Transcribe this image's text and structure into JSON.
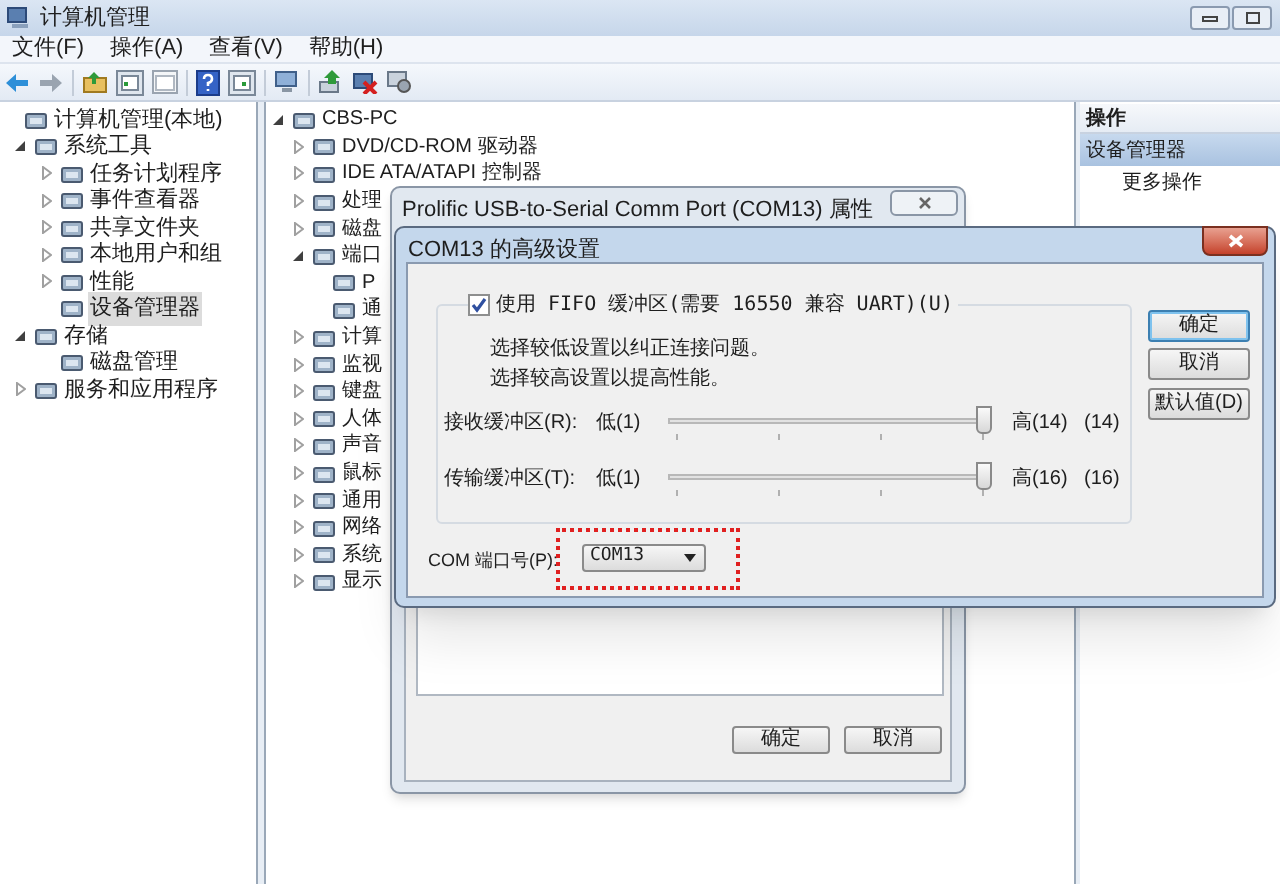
{
  "window": {
    "title": "计算机管理",
    "menu": [
      "文件(F)",
      "操作(A)",
      "查看(V)",
      "帮助(H)"
    ]
  },
  "nav_tree": [
    {
      "label": "计算机管理(本地)",
      "selected": false,
      "children": [
        {
          "label": "系统工具",
          "expanded": true,
          "selected": false,
          "children": [
            {
              "label": "任务计划程序",
              "expanded": false,
              "selected": false
            },
            {
              "label": "事件查看器",
              "expanded": false,
              "selected": false
            },
            {
              "label": "共享文件夹",
              "expanded": false,
              "selected": false
            },
            {
              "label": "本地用户和组",
              "expanded": false,
              "selected": false
            },
            {
              "label": "性能",
              "expanded": false,
              "selected": false
            },
            {
              "label": "设备管理器",
              "selected": true
            }
          ]
        },
        {
          "label": "存储",
          "expanded": true,
          "selected": false,
          "children": [
            {
              "label": "磁盘管理",
              "selected": false
            }
          ]
        },
        {
          "label": "服务和应用程序",
          "expanded": false,
          "selected": false
        }
      ]
    }
  ],
  "device_tree": [
    {
      "label": "CBS-PC",
      "expanded": true,
      "children": [
        {
          "label": "DVD/CD-ROM 驱动器",
          "expanded": false
        },
        {
          "label": "IDE ATA/ATAPI 控制器",
          "expanded": false
        },
        {
          "label": "处理",
          "expanded": false
        },
        {
          "label": "磁盘",
          "expanded": false
        },
        {
          "label": "端口",
          "expanded": true,
          "children": [
            {
              "label": "P"
            },
            {
              "label": "通"
            }
          ]
        },
        {
          "label": "计算",
          "expanded": false
        },
        {
          "label": "监视",
          "expanded": false
        },
        {
          "label": "键盘",
          "expanded": false
        },
        {
          "label": "人体",
          "expanded": false
        },
        {
          "label": "声音",
          "expanded": false
        },
        {
          "label": "鼠标",
          "expanded": false
        },
        {
          "label": "通用",
          "expanded": false
        },
        {
          "label": "网络",
          "expanded": false
        },
        {
          "label": "系统",
          "expanded": false
        },
        {
          "label": "显示",
          "expanded": false
        }
      ]
    }
  ],
  "actions_pane": {
    "header": "操作",
    "items": [
      {
        "label": "设备管理器",
        "selected": true
      },
      {
        "label": "更多操作",
        "selected": false
      }
    ]
  },
  "properties_dialog": {
    "title": "Prolific USB-to-Serial Comm Port (COM13) 属性",
    "buttons": [
      "确定",
      "取消"
    ]
  },
  "advanced_dialog": {
    "title": "COM13 的高级设置",
    "fifo": {
      "label": "使用 FIFO 缓冲区(需要 16550 兼容 UART)(U)",
      "checked": true
    },
    "hints": [
      "选择较低设置以纠正连接问题。",
      "选择较高设置以提高性能。"
    ],
    "sliders": [
      {
        "label": "接收缓冲区(R):",
        "low": "低(1)",
        "level": 1,
        "high": "高(14)",
        "reading": "(14)"
      },
      {
        "label": "传输缓冲区(T):",
        "low": "低(1)",
        "level": 1,
        "high": "高(16)",
        "reading": "(16)"
      }
    ],
    "com_port": {
      "label": "COM 端口号(P):",
      "value": "COM13",
      "highlighted": true
    },
    "buttons": [
      {
        "label": "确定",
        "default": true
      },
      {
        "label": "取消",
        "default": false
      },
      {
        "label": "默认值(D)",
        "default": false
      }
    ]
  }
}
